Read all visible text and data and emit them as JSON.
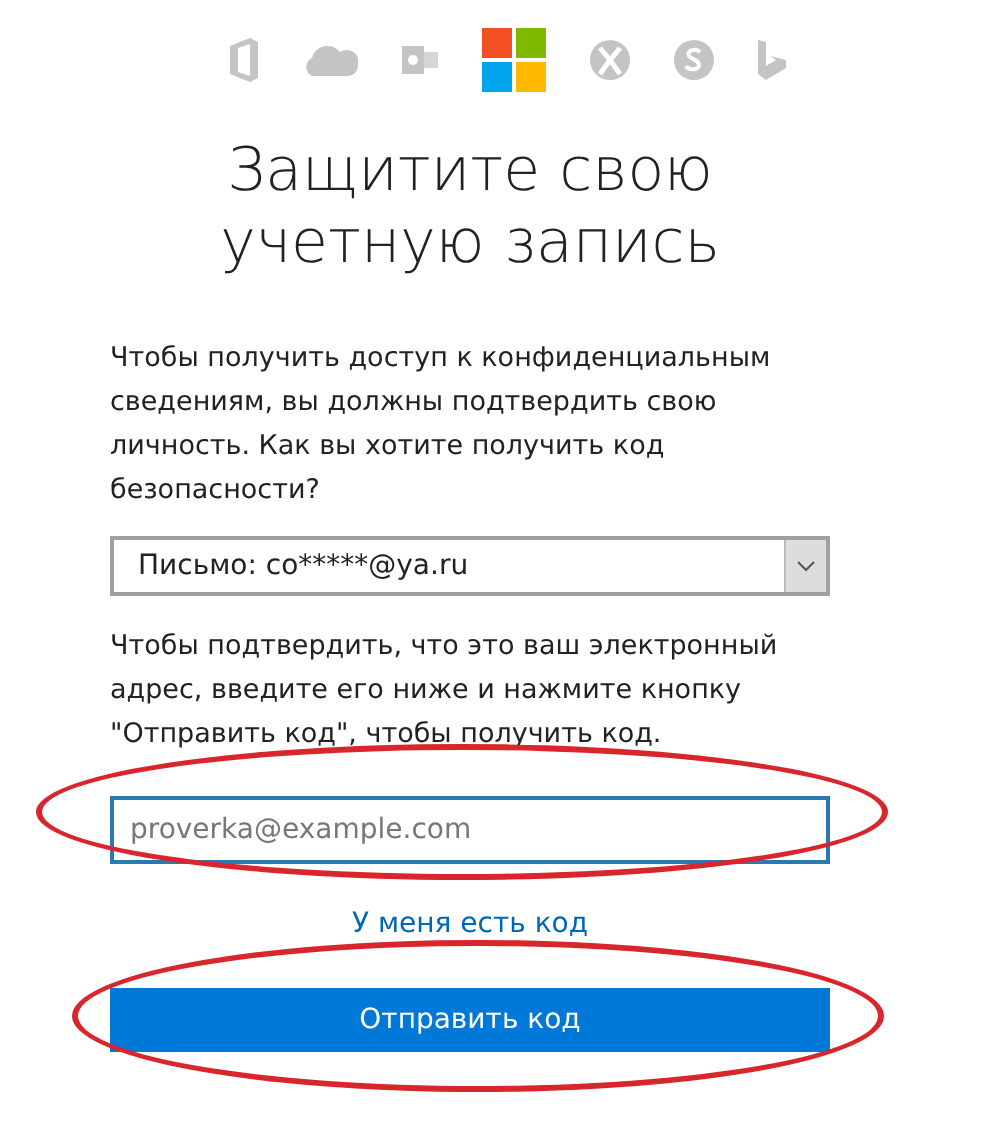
{
  "title_lines": [
    "Защитите свою",
    "учетную запись"
  ],
  "intro": "Чтобы получить доступ к конфиденциальным сведениям, вы должны подтвердить свою личность. Как вы хотите получить код безопасности?",
  "method_select": {
    "value": "Письмо: co*****@ya.ru"
  },
  "instructions": "Чтобы подтвердить, что это ваш электронный адрес, введите его ниже и нажмите кнопку \"Отправить код\", чтобы получить код.",
  "email_field": {
    "placeholder": "proverka@example.com",
    "focused": true
  },
  "have_code_link": "У меня есть код",
  "send_button": "Отправить код"
}
